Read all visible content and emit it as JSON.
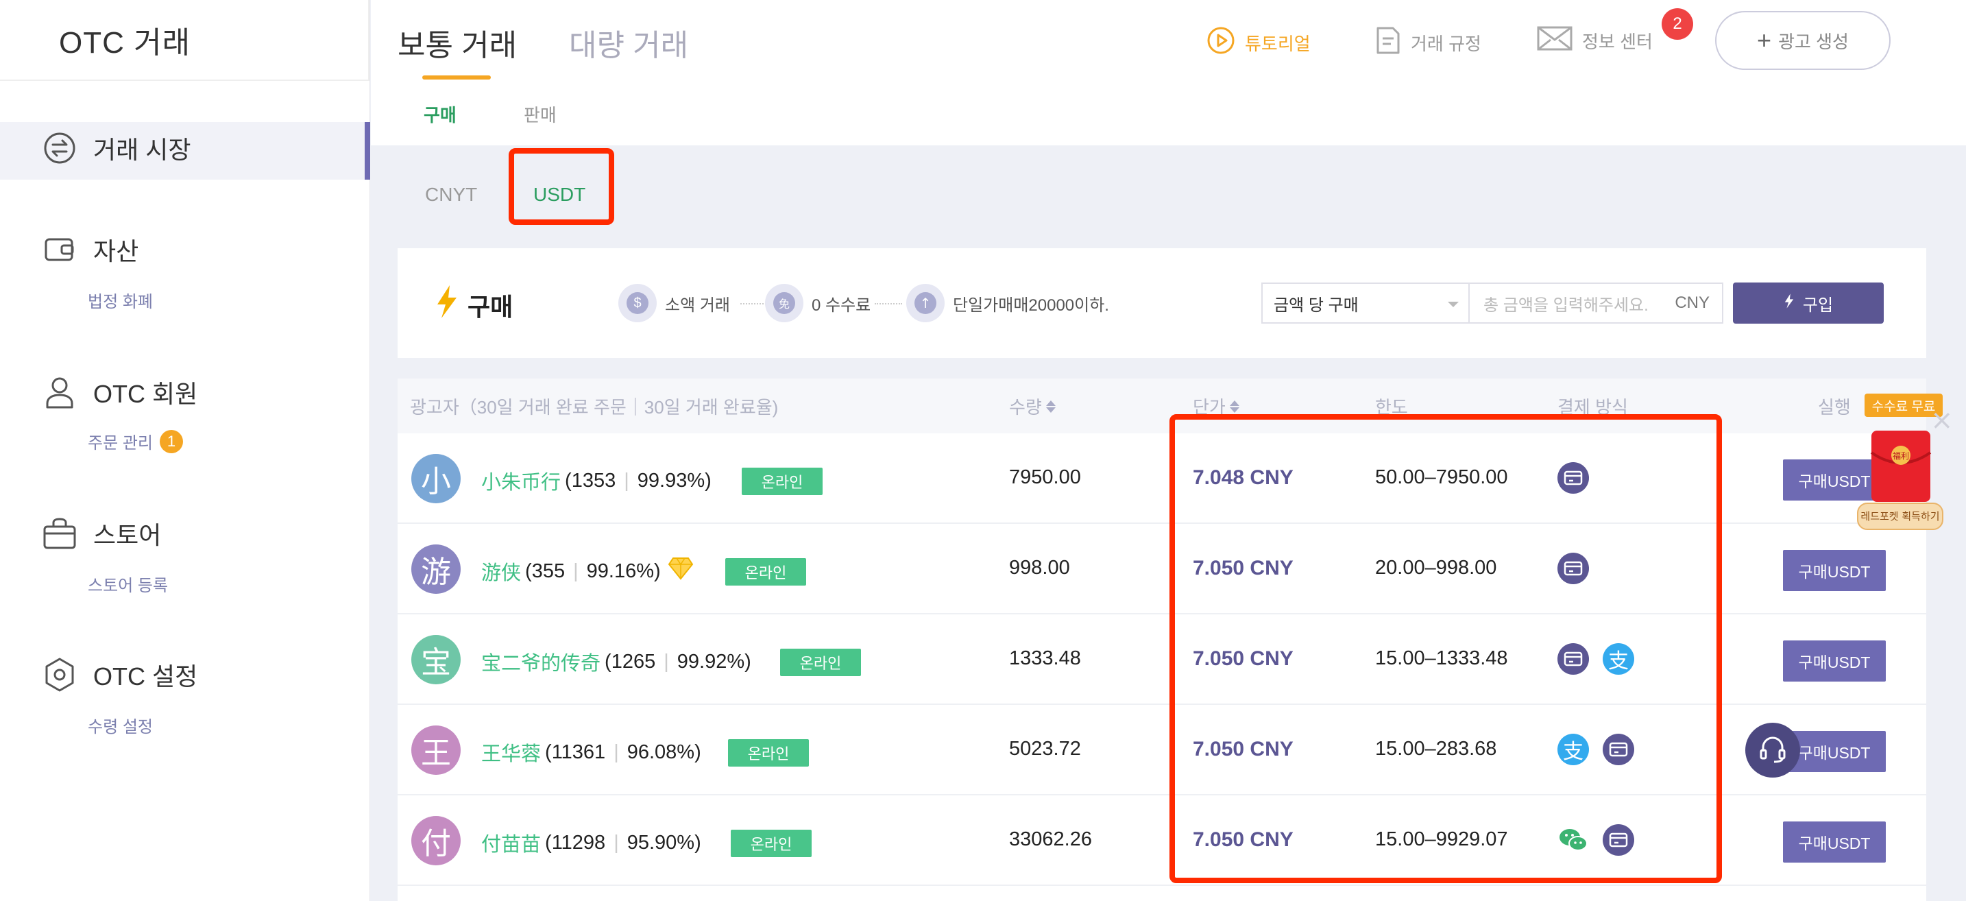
{
  "sidebar": {
    "brand": "OTC 거래",
    "items": [
      {
        "label": "거래 시장",
        "icon": "exchange-icon",
        "sub": ""
      },
      {
        "label": "자산",
        "icon": "wallet-icon",
        "sub": "법정 화폐"
      },
      {
        "label": "OTC 회원",
        "icon": "user-icon",
        "sub": "주문 관리",
        "badge": "1"
      },
      {
        "label": "스토어",
        "icon": "bag-icon",
        "sub": "스토어 등록"
      },
      {
        "label": "OTC 설정",
        "icon": "settings-hexagon-icon",
        "sub": "수령 설정"
      }
    ]
  },
  "header": {
    "main_tabs": [
      "보통 거래",
      "대량 거래"
    ],
    "sub_tabs": [
      "구매",
      "판매"
    ],
    "tools": {
      "tutorial": "튜토리얼",
      "rules": "거래 규정",
      "info": "정보 센터",
      "info_badge": "2",
      "create_ad": "광고 생성"
    }
  },
  "coins": [
    "CNYT",
    "USDT"
  ],
  "buy_panel": {
    "title": "구매",
    "features": [
      {
        "icon": "$",
        "label": "소액 거래"
      },
      {
        "icon": "免",
        "label": "0 수수료"
      },
      {
        "icon": "↑",
        "label": "단일가매매20000이하."
      }
    ],
    "mode_select": "금액 당 구매",
    "amount_placeholder": "총 금액을 입력해주세요.",
    "amount_unit": "CNY",
    "purchase_button": "구입"
  },
  "table": {
    "headers": {
      "advertiser": "광고자（30일 거래 완료 주문｜30일 거래 완료율)",
      "quantity": "수량",
      "price": "단가",
      "limit": "한도",
      "payment": "결제 방식",
      "action": "실행"
    },
    "rows": [
      {
        "avatar": "小",
        "avatar_color": "#7aa7d6",
        "name": "小朱币行",
        "orders": "1353",
        "rate": "99.93%)",
        "status": "온라인",
        "qty": "7950.00",
        "price": "7.048 CNY",
        "limit": "50.00–7950.00",
        "pay": [
          "card"
        ],
        "button": "구매USDT"
      },
      {
        "avatar": "游",
        "avatar_color": "#8a86c2",
        "name": "游侠",
        "orders": "355",
        "rate": "99.16%)",
        "status": "온라인",
        "qty": "998.00",
        "price": "7.050 CNY",
        "limit": "20.00–998.00",
        "pay": [
          "card"
        ],
        "button": "구매USDT"
      },
      {
        "avatar": "宝",
        "avatar_color": "#6fc6a7",
        "name": "宝二爷的传奇",
        "orders": "1265",
        "rate": "99.92%)",
        "status": "온라인",
        "qty": "1333.48",
        "price": "7.050 CNY",
        "limit": "15.00–1333.48",
        "pay": [
          "card",
          "ali"
        ],
        "button": "구매USDT"
      },
      {
        "avatar": "王",
        "avatar_color": "#c58cc2",
        "name": "王华蓉",
        "orders": "11361",
        "rate": "96.08%)",
        "status": "온라인",
        "qty": "5023.72",
        "price": "7.050 CNY",
        "limit": "15.00–283.68",
        "pay": [
          "ali",
          "card"
        ],
        "button": "구매USDT"
      },
      {
        "avatar": "付",
        "avatar_color": "#c58cc2",
        "name": "付苗苗",
        "orders": "11298",
        "rate": "95.90%)",
        "status": "온라인",
        "qty": "33062.26",
        "price": "7.050 CNY",
        "limit": "15.00–9929.07",
        "pay": [
          "wechat",
          "card"
        ],
        "button": "구매USDT"
      }
    ]
  },
  "promo": {
    "tag": "수수료 무료",
    "envelope_caption": "레드포켓 획득하기",
    "envelope_label": "福利"
  },
  "colors": {
    "accent": "#5b5693",
    "green": "#49c58a",
    "orange": "#f5a623",
    "highlight": "#ff2a00"
  }
}
